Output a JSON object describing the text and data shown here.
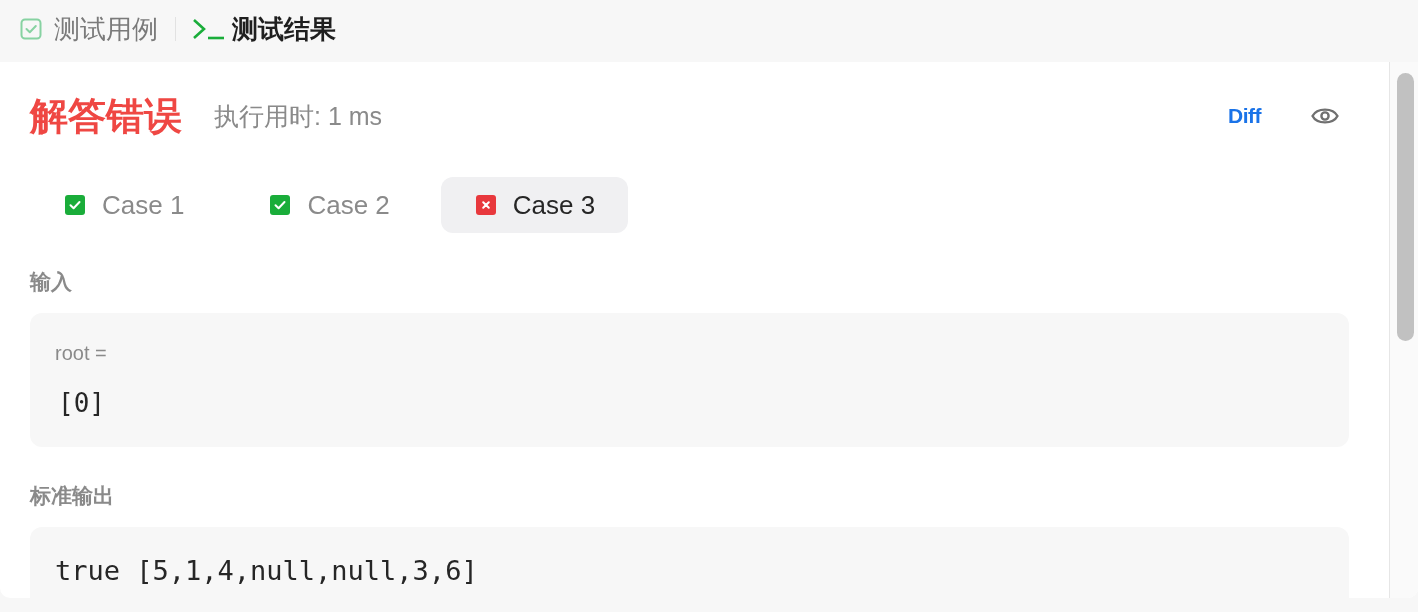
{
  "header_tabs": [
    {
      "kind": "testcase",
      "label": "测试用例",
      "selected": false
    },
    {
      "kind": "result",
      "label": "测试结果",
      "selected": true
    }
  ],
  "result": {
    "accepted": false,
    "status": "解答错误",
    "runtime": "执行用时: 1 ms",
    "diff_button": "Diff"
  },
  "cases": [
    {
      "label": "Case 1",
      "passed": true,
      "selected": false
    },
    {
      "label": "Case 2",
      "passed": true,
      "selected": false
    },
    {
      "label": "Case 3",
      "passed": false,
      "selected": true
    }
  ],
  "input": {
    "label": "输入",
    "params": [
      {
        "name": "root =",
        "value": "[0]"
      }
    ]
  },
  "stdout": {
    "label": "标准输出",
    "value": "true [5,1,4,null,null,3,6]"
  }
}
